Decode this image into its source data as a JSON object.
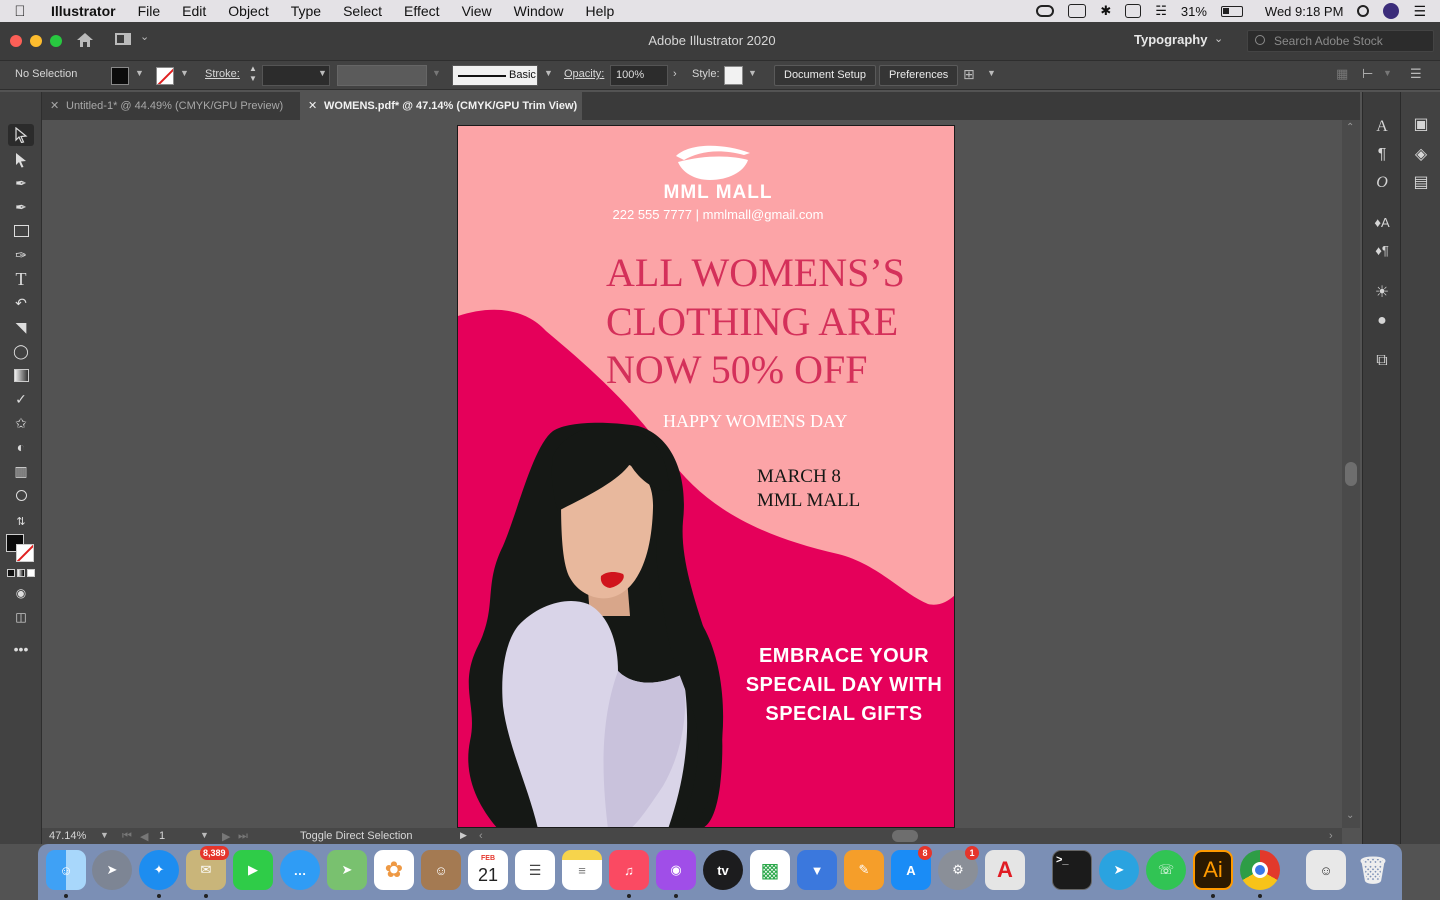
{
  "menubar": {
    "app": "Illustrator",
    "items": [
      "File",
      "Edit",
      "Object",
      "Type",
      "Select",
      "Effect",
      "View",
      "Window",
      "Help"
    ],
    "battery": "31%",
    "clock": "Wed 9:18 PM"
  },
  "titlebar": {
    "title": "Adobe Illustrator 2020",
    "workspace": "Typography",
    "stock_placeholder": "Search Adobe Stock"
  },
  "control": {
    "selection": "No Selection",
    "stroke_label": "Stroke:",
    "brush": "Basic",
    "opacity_label": "Opacity:",
    "opacity_value": "100%",
    "style_label": "Style:",
    "doc_setup": "Document Setup",
    "preferences": "Preferences"
  },
  "tabs": [
    {
      "label": "Untitled-1* @ 44.49% (CMYK/GPU Preview)",
      "active": false
    },
    {
      "label": "WOMENS.pdf* @ 47.14% (CMYK/GPU Trim View)",
      "active": true
    }
  ],
  "status": {
    "zoom": "47.14%",
    "artboard_num": "1",
    "message": "Toggle Direct Selection"
  },
  "poster": {
    "brand": "MML MALL",
    "contact": "222 555 7777 | mmlmall@gmail.com",
    "headline": [
      "ALL WOMENS’S",
      "CLOTHING ARE",
      "NOW 50% OFF"
    ],
    "sub": "HAPPY WOMENS DAY",
    "date": "MARCH 8",
    "venue": "MML MALL",
    "tagline": [
      "EMBRACE YOUR",
      "SPECAIL DAY WITH",
      "SPECIAL GIFTS"
    ],
    "colors": {
      "bg": "#fca4a7",
      "accent": "#e5005a",
      "headline": "#d4305a",
      "hair": "#151815",
      "skin": "#e8b89d",
      "dress": "#d9d4e8",
      "lips": "#d0141c"
    }
  },
  "dock": {
    "mail_badge": "8,389",
    "calendar_month": "FEB",
    "calendar_day": "21",
    "appstore_badge": "8",
    "prefs_badge": "1",
    "tv_label": "tv",
    "ai_label": "Ai"
  }
}
